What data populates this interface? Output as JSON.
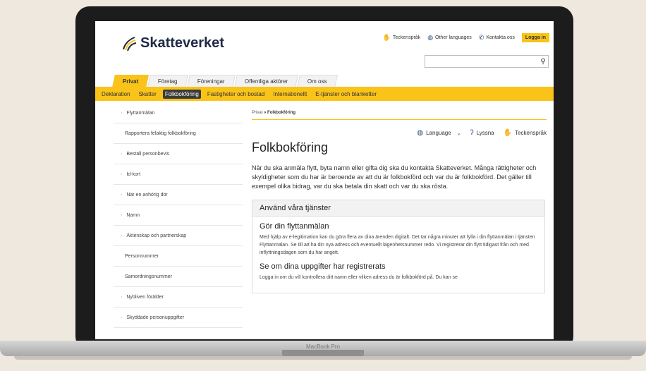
{
  "header": {
    "logo_text": "Skatteverket",
    "util_links": [
      {
        "label": "Teckenspråk",
        "icon": "sign-language-icon"
      },
      {
        "label": "Other languages",
        "icon": "globe-icon"
      },
      {
        "label": "Kontakta oss",
        "icon": "phone-icon"
      }
    ],
    "login_label": "Logga in"
  },
  "tabs": [
    "Privat",
    "Företag",
    "Föreningar",
    "Offentliga aktörer",
    "Om oss"
  ],
  "subnav": [
    "Deklaration",
    "Skatter",
    "Folkbokföring",
    "Fastigheter och bostad",
    "Internationellt",
    "E-tjänster och blanketter"
  ],
  "sidebar": [
    "Flyttanmälan",
    "Rapportera felaktig folkbokföring",
    "Beställ personbevis",
    "Id-kort",
    "När en anhörig dör",
    "Namn",
    "Äktenskap och partnerskap",
    "Personnummer",
    "Samordningsnummer",
    "Nybliven förälder",
    "Skyddade personuppgifter"
  ],
  "breadcrumb": {
    "root": "Privat",
    "sep": "»",
    "current": "Folkbokföring"
  },
  "tools": {
    "language": "Language",
    "listen": "Lyssna",
    "sign": "Teckenspråk"
  },
  "main": {
    "title": "Folkbokföring",
    "intro": "När du ska anmäla flytt, byta namn eller gifta dig ska du kontakta Skatteverket. Många rättigheter och skyldigheter som du har är beroende av att du är folkbokförd och var du är folkbokförd. Det gäller till exempel olika bidrag, var du ska betala din skatt och var du ska rösta.",
    "box_title": "Använd våra tjänster",
    "s1_title": "Gör din flyttanmälan",
    "s1_text": "Med hjälp av e-legitimation kan du göra flera av dina ärenden digitalt. Det tar några minuter att fylla i din flyttanmälan i tjänsten Flyttanmälan. Se till att ha din nya adress och eventuellt lägenhetsnummer redo. Vi registrerar din flytt tidigast från och med inflyttningsdagen som du har angett.",
    "s2_title": "Se om dina uppgifter har registrerats",
    "s2_text": "Logga in om du vill kontrollera ditt namn eller vilken adress du är folkbokförd på. Du kan se"
  },
  "device_label": "MacBook Pro",
  "colors": {
    "accent": "#f9c319",
    "brand": "#1f2a44",
    "bezel": "#1c1c1c"
  }
}
